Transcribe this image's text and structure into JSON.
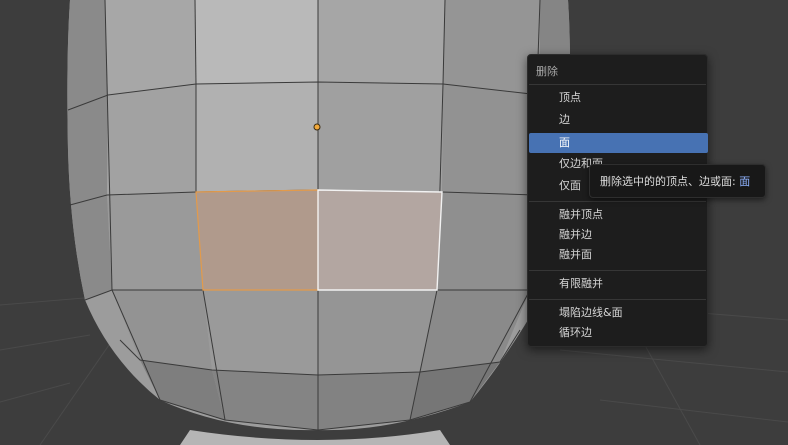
{
  "viewport": {
    "background": "#3d3d3d",
    "mesh_color": "#a8a8a8",
    "selection_color": "#ff9a2e"
  },
  "delete_menu": {
    "title": "删除",
    "items": [
      {
        "label": "顶点",
        "active": false
      },
      {
        "label": "边",
        "active": false
      },
      {
        "label": "面",
        "active": true
      },
      {
        "label": "仅边和面",
        "active": false
      },
      {
        "label": "仅面",
        "active": false
      },
      {
        "label": "融并顶点",
        "active": false
      },
      {
        "label": "融并边",
        "active": false
      },
      {
        "label": "融并面",
        "active": false
      },
      {
        "label": "有限融并",
        "active": false
      },
      {
        "label": "塌陷边线&面",
        "active": false
      },
      {
        "label": "循环边",
        "active": false
      }
    ],
    "accent": "#4772b3"
  },
  "tooltip": {
    "text": "删除选中的的顶点、边或面: ",
    "highlight": "面"
  }
}
